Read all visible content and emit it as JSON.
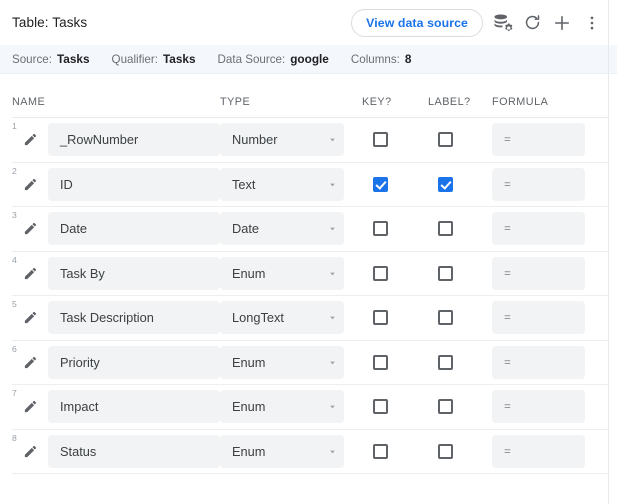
{
  "window": {
    "title": "Table: Tasks"
  },
  "toolbar": {
    "view_data_source_label": "View data source",
    "icons": [
      {
        "name": "database-settings-icon",
        "label": "Data source settings"
      },
      {
        "name": "refresh-icon",
        "label": "Regenerate"
      },
      {
        "name": "plus-icon",
        "label": "Add"
      },
      {
        "name": "more-vert-icon",
        "label": "More options"
      }
    ]
  },
  "meta_bar": {
    "items": [
      {
        "label": "Source:",
        "value": "Tasks"
      },
      {
        "label": "Qualifier:",
        "value": "Tasks"
      },
      {
        "label": "Data Source:",
        "value": "google"
      },
      {
        "label": "Columns:",
        "value": "8"
      }
    ]
  },
  "table": {
    "headers": {
      "name": "NAME",
      "type": "TYPE",
      "key": "KEY?",
      "label": "LABEL?",
      "formula": "FORMULA"
    },
    "formula_value": "=",
    "rows": [
      {
        "num": "1",
        "name": "_RowNumber",
        "type": "Number",
        "key": false,
        "label": false,
        "formula": "="
      },
      {
        "num": "2",
        "name": "ID",
        "type": "Text",
        "key": true,
        "label": true,
        "formula": "="
      },
      {
        "num": "3",
        "name": "Date",
        "type": "Date",
        "key": false,
        "label": false,
        "formula": "="
      },
      {
        "num": "4",
        "name": "Task By",
        "type": "Enum",
        "key": false,
        "label": false,
        "formula": "="
      },
      {
        "num": "5",
        "name": "Task Description",
        "type": "LongText",
        "key": false,
        "label": false,
        "formula": "="
      },
      {
        "num": "6",
        "name": "Priority",
        "type": "Enum",
        "key": false,
        "label": false,
        "formula": "="
      },
      {
        "num": "7",
        "name": "Impact",
        "type": "Enum",
        "key": false,
        "label": false,
        "formula": "="
      },
      {
        "num": "8",
        "name": "Status",
        "type": "Enum",
        "key": false,
        "label": false,
        "formula": "="
      }
    ]
  },
  "colors": {
    "accent_blue": "#1a73e8",
    "field_bg": "#f1f3f4",
    "meta_bar_bg": "#f4f7fc",
    "text_primary": "#202124",
    "text_secondary": "#5f6368"
  }
}
